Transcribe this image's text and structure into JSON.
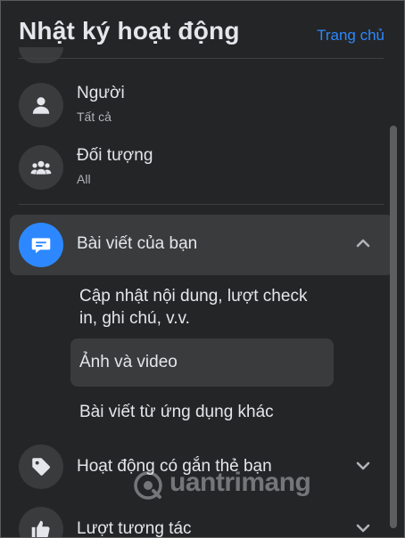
{
  "header": {
    "title": "Nhật ký hoạt động",
    "home_link": "Trang chủ"
  },
  "filters": [
    {
      "label": "Người",
      "value": "Tất cả",
      "icon": "person-icon"
    },
    {
      "label": "Đối tượng",
      "value": "All",
      "icon": "people-group-icon"
    }
  ],
  "sections": [
    {
      "label": "Bài viết của bạn",
      "icon": "message-icon",
      "expanded": true,
      "children": [
        {
          "label": "Cập nhật nội dung, lượt check in, ghi chú, v.v."
        },
        {
          "label": "Ảnh và video",
          "selected": true
        },
        {
          "label": "Bài viết từ ứng dụng khác"
        }
      ]
    },
    {
      "label": "Hoạt động có gắn thẻ bạn",
      "icon": "tag-icon",
      "expanded": false
    },
    {
      "label": "Lượt tương tác",
      "icon": "thumbs-up-icon",
      "expanded": false
    }
  ],
  "watermark": {
    "text": "uantrimang",
    "icon": "quantrimang-logo"
  },
  "colors": {
    "background": "#242526",
    "surface": "#3a3b3c",
    "text_primary": "#e4e6eb",
    "text_secondary": "#b0b3b8",
    "accent": "#2d88ff"
  }
}
